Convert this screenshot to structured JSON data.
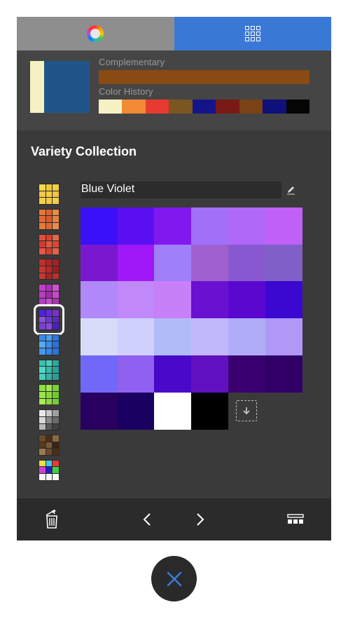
{
  "tabs": [
    {
      "name": "color-wheel",
      "icon": "color-wheel-icon",
      "active": false
    },
    {
      "name": "palettes",
      "icon": "grid-icon",
      "active": true
    }
  ],
  "current_color": {
    "primary": "#f6f1c3",
    "secondary": "#21558a"
  },
  "complementary": {
    "label": "Complementary",
    "color": "#8a4a14"
  },
  "history": {
    "label": "Color History",
    "colors": [
      "#f6f1c3",
      "#f08a35",
      "#e83a30",
      "#7a5620",
      "#14148a",
      "#7a1a16",
      "#7a4216",
      "#10107a",
      "#050505"
    ]
  },
  "collection": {
    "title": "Variety Collection"
  },
  "palette_name": "Blue Violet",
  "collection_thumbs": [
    [
      "#f5d94a",
      "#f3c73c",
      "#f2d042",
      "#f6c64a",
      "#f3ce3e",
      "#f0c444",
      "#f4d246",
      "#f3c940",
      "#f2cf46"
    ],
    [
      "#e8743a",
      "#e2602c",
      "#e98a42",
      "#e06a36",
      "#d95a2c",
      "#ea8040",
      "#e57a3a",
      "#e2682f",
      "#ea8c48"
    ],
    [
      "#e0503a",
      "#d8402e",
      "#e26a48",
      "#d43c2c",
      "#e05a40",
      "#d84832",
      "#e2584a",
      "#d6402e",
      "#e0624a"
    ],
    [
      "#c0302a",
      "#b02426",
      "#a62024",
      "#c83830",
      "#b42a28",
      "#9a1e20",
      "#c23a32",
      "#aa2426",
      "#b83030"
    ],
    [
      "#c040c8",
      "#a830b8",
      "#d050d0",
      "#b83cc4",
      "#a02aa8",
      "#c848cc",
      "#b040bc",
      "#c050c8",
      "#a834b0"
    ],
    [
      "#5020e0",
      "#6a28d8",
      "#7a30c8",
      "#8a50d8",
      "#6a3ad0",
      "#5a2ac0",
      "#7a40d0",
      "#8848d8",
      "#4a20c0"
    ],
    [
      "#3a8ae8",
      "#4aa0f0",
      "#2a78e0",
      "#5aa8f0",
      "#3a90e8",
      "#2a70d8",
      "#4a98ec",
      "#3a84e4",
      "#2a74dc"
    ],
    [
      "#3ac0b0",
      "#4ad0c0",
      "#2aa8a0",
      "#50d8c8",
      "#3ab8a8",
      "#2aa098",
      "#48ccbc",
      "#3ab0a4",
      "#2a9c94"
    ],
    [
      "#8ae040",
      "#a0e850",
      "#7ad036",
      "#98e44c",
      "#86d840",
      "#70c830",
      "#a4ea5a",
      "#8ed848",
      "#76cc38"
    ],
    [
      "#e8e8e8",
      "#c8c8c8",
      "#a0a0a0",
      "#d8d8d8",
      "#888888",
      "#6a6a6a",
      "#b8b8b8",
      "#585858",
      "#404040"
    ],
    [
      "#6a4a28",
      "#4a3018",
      "#8a6a40",
      "#5a3a20",
      "#7a5a38",
      "#3a2412",
      "#9a7a50",
      "#6a4a2a",
      "#4a301a"
    ],
    [
      "#f0e040",
      "#40c8e8",
      "#e83838",
      "#d040d0",
      "#2020c0",
      "#40d040",
      "#f8f8f8",
      "#f8f8f8",
      "#f8f8f8"
    ]
  ],
  "selected_thumb": 5,
  "palette": [
    [
      "#3a10f8",
      "#5a10f0",
      "#8018f0",
      "#a070f8",
      "#b068f8",
      "#c060f8"
    ],
    [
      "#7a18d0",
      "#a018f8",
      "#a080f8",
      "#a060d0",
      "#8858d0",
      "#8060c8"
    ],
    [
      "#b088f8",
      "#c088f8",
      "#c880f8",
      "#6a10d0",
      "#5a08d0",
      "#3a08d0"
    ],
    [
      "#d8dcf8",
      "#d0d0fc",
      "#b0bcf8",
      "#c0b8f8",
      "#b0acf8",
      "#b098f8"
    ],
    [
      "#7068f8",
      "#9060f0",
      "#4a08c8",
      "#6010c0",
      "#3a0070",
      "#300068"
    ],
    [
      "#280060",
      "#1a0060",
      "#ffffff",
      "#000000"
    ]
  ],
  "icons": {
    "edit": "pencil-icon",
    "save": "save-to-palette-icon",
    "delete": "trash-icon",
    "prev": "chevron-left-icon",
    "next": "chevron-right-icon",
    "palette": "palette-strip-icon",
    "close": "close-icon"
  },
  "accent": "#3a78d6"
}
